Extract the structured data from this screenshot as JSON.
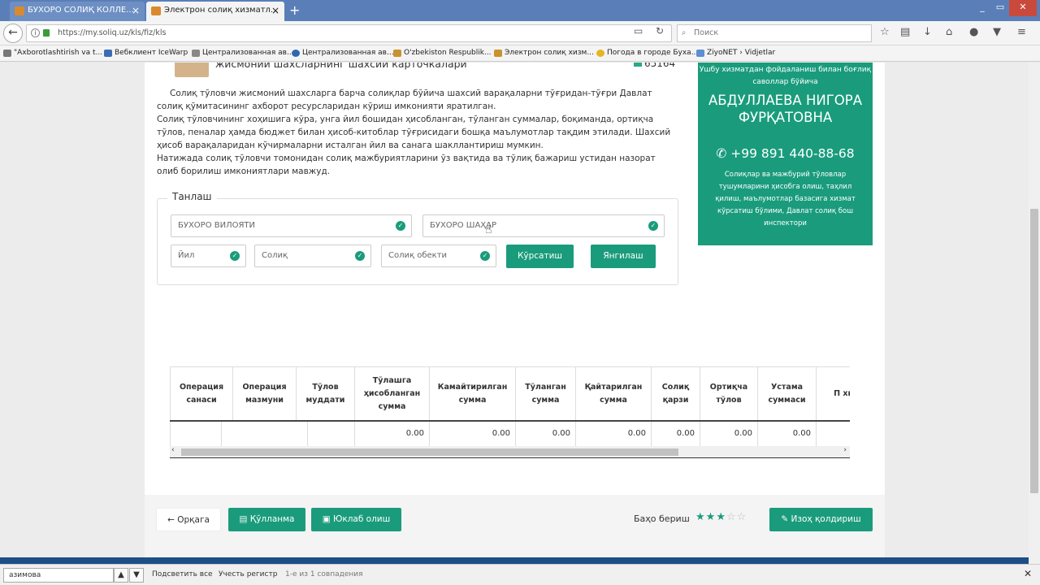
{
  "browser": {
    "tabs": [
      {
        "title": "БУХОРО СОЛИҚ КОЛЛЕ...",
        "active": false
      },
      {
        "title": "Электрон солиқ хизматл...",
        "active": true
      }
    ],
    "new_tab": "+",
    "tab_close": "×",
    "window_controls": [
      "▭",
      "—",
      "✕"
    ],
    "url": "https://my.soliq.uz/kls/fiz/kls",
    "search_placeholder": "Поиск",
    "bookmarks": [
      "\"Axborotlashtirish va t...",
      "Вебклиент IceWarp",
      "Централизованная ав...",
      "Централизованная ав...",
      "O'zbekiston Respublik...",
      "Электрон солиқ хизм...",
      "Погода в городе Буха...",
      "ZiyoNET › Vidjetlar"
    ]
  },
  "page": {
    "heading": "жисмонии шахсларнинг шахсий карточкалари",
    "counter": "65164",
    "description": [
      "Солиқ тўловчи жисмоний шахсларга барча солиқлар бўйича шахсий варақаларни тўғридан-тўғри Давлат солиқ қўмитасининг ахборот ресурсларидан кўриш имконияти яратилган.",
      "Солиқ тўловчининг хоҳишига кўра, унга йил бошидан ҳисобланган, тўланган суммалар, боқимандa, ортиқча тўлов, пеналар ҳамда бюджет билан ҳисоб-китоблар тўғрисидаги бошқа маълумотлар тақдим этилади. Шахсий ҳисоб варақаларидан кўчирмаларни исталган йил ва санага шакллантириш мумкин.",
      "Натижада солиқ тўловчи томонидан солиқ мажбуриятларини ўз вақтида ва тўлиқ бажариш устидан назорат олиб борилиш имкониятлари мавжуд."
    ],
    "filter": {
      "legend": "Танлаш",
      "region": "БУХОРО ВИЛОЯТИ",
      "city": "БУХОРО ШАҲАР",
      "year": "Йил",
      "tax": "Солиқ",
      "object": "Солиқ обекти",
      "show_button": "Кўрсатиш",
      "refresh_button": "Янгилаш"
    },
    "contact": {
      "intro": "Ушбу хизматдан фойдаланиш билан боғлиқ саволлар бўйича",
      "name": "АБДУЛЛАЕВА НИГОРА ФУРҚАТОВНА",
      "phone": "+99 891 440-88-68",
      "department": "Солиқлар ва мажбурий тўловлар тушумларини ҳисобга олиш, таҳлил қилиш, маълумотлар базасига хизмат кўрсатиш бўлими, Давлат солиқ бош инспектори"
    },
    "table": {
      "headers": [
        "Операция санаси",
        "Операция мазмуни",
        "Тўлов муддати",
        "Тўлашга ҳисобланган сумма",
        "Камайтирилган сумма",
        "Тўланган сумма",
        "Қайтарилган сумма",
        "Солиқ қарзи",
        "Ортиқча тўлов",
        "Устама суммаси",
        "П хисоб д"
      ],
      "row": [
        "",
        "",
        "",
        "0.00",
        "0.00",
        "0.00",
        "0.00",
        "0.00",
        "0.00",
        "0.00",
        ""
      ]
    },
    "footer": {
      "back": "Орқага",
      "manual": "Қўлланма",
      "download": "Юклаб олиш",
      "rate_label": "Баҳо бериш",
      "rating": 3,
      "rating_max": 5,
      "comment": "Изоҳ қолдириш"
    }
  },
  "findbar": {
    "query": "азимова",
    "highlight_all": "Подсветить все",
    "match_case": "Учесть регистр",
    "status": "1-е из 1 совпадения"
  },
  "colors": {
    "accent": "#1a9c7c",
    "tabbar": "#5a7fb8"
  }
}
